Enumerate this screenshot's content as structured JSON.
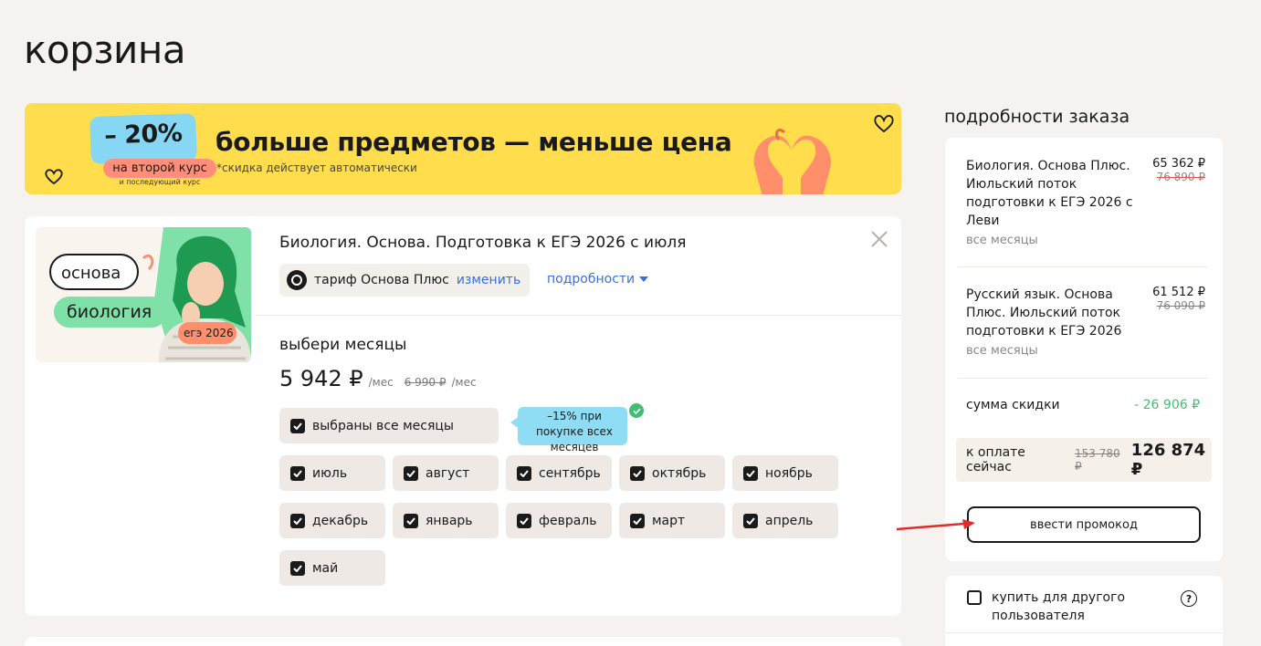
{
  "page": {
    "title": "корзина"
  },
  "banner": {
    "discount": "– 20%",
    "pill": "на второй курс",
    "pill_sub": "и последующий курс",
    "headline": "больше предметов — меньше цена",
    "note": "*скидка действует автоматически",
    "bg_color": "#ffdd4d"
  },
  "course": {
    "thumb": {
      "tag1": "основа",
      "tag2": "биология",
      "badge": "егэ 2026"
    },
    "title": "Биология. Основа. Подготовка к ЕГЭ 2026 с июля",
    "tariff_label": "тариф Основа Плюс",
    "change_link": "изменить",
    "details_link": "подробности",
    "months_title": "выбери месяцы",
    "price": "5 942 ₽",
    "price_unit": "/мес",
    "price_old": "6 990 ₽",
    "price_old_unit": "/мес",
    "all_months": "выбраны все месяцы",
    "promo_tag": "–15% при покупке всех месяцев",
    "months": [
      "июль",
      "август",
      "сентябрь",
      "октябрь",
      "ноябрь",
      "декабрь",
      "январь",
      "февраль",
      "март",
      "апрель",
      "май"
    ]
  },
  "summary": {
    "title": "подробности заказа",
    "items": [
      {
        "name": "Биология. Основа Плюс. Июльский поток подготовки к ЕГЭ 2026 с Леви",
        "sub": "все месяцы",
        "price": "65 362 ₽",
        "old": "76 890 ₽"
      },
      {
        "name": "Русский язык. Основа Плюс. Июльский поток подготовки к ЕГЭ 2026",
        "sub": "все месяцы",
        "price": "61 512 ₽",
        "old": "76 090 ₽"
      }
    ],
    "discount_label": "сумма скидки",
    "discount_value": "- 26 906 ₽",
    "pay_label": "к оплате сейчас",
    "pay_old": "153 780 ₽",
    "pay_total": "126 874 ₽",
    "promo_button": "ввести промокод",
    "accent_discount": "#3fbf72"
  },
  "gift": {
    "label": "купить для другого пользователя",
    "help": "?"
  }
}
